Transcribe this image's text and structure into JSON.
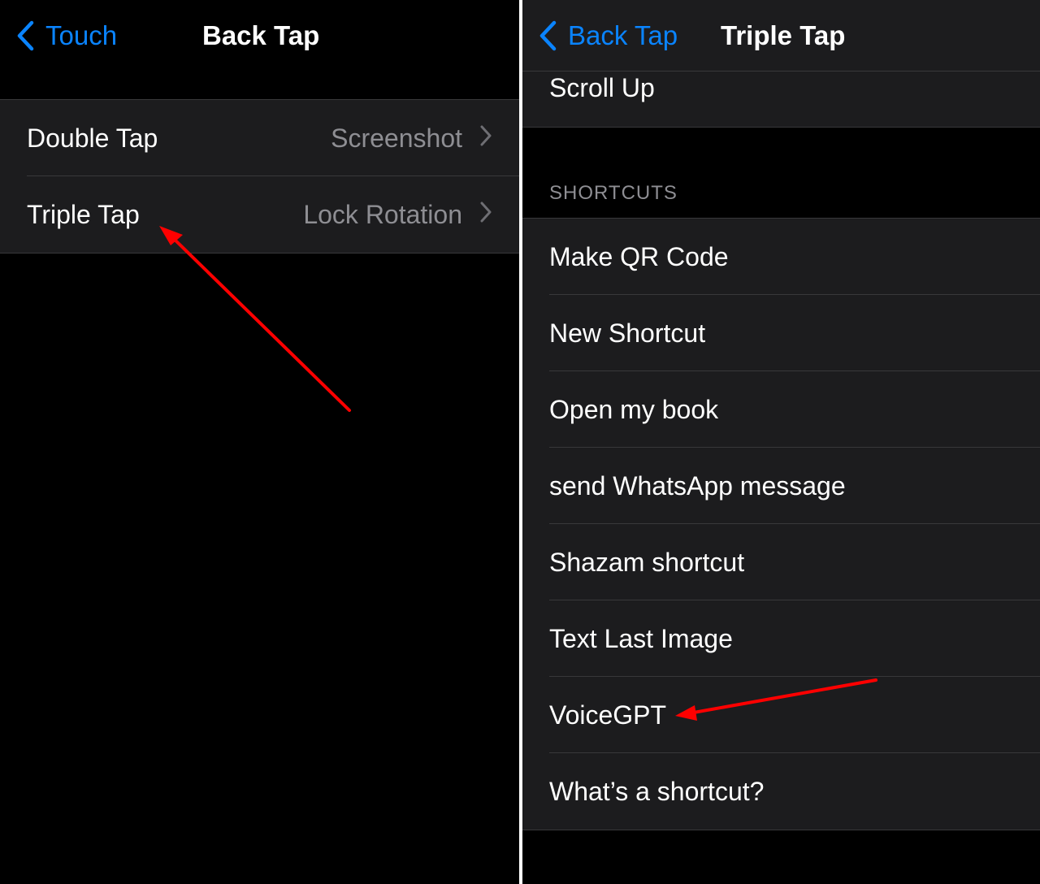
{
  "left": {
    "nav": {
      "back_label": "Touch",
      "title": "Back Tap"
    },
    "rows": [
      {
        "label": "Double Tap",
        "value": "Screenshot"
      },
      {
        "label": "Triple Tap",
        "value": "Lock Rotation"
      }
    ]
  },
  "right": {
    "nav": {
      "back_label": "Back Tap",
      "title": "Triple Tap"
    },
    "top_row": {
      "label": "Scroll Up"
    },
    "section_header": "SHORTCUTS",
    "shortcuts": [
      "Make QR Code",
      "New Shortcut",
      "Open my book",
      "send WhatsApp message",
      "Shazam shortcut",
      "Text Last Image",
      "VoiceGPT",
      "What’s a shortcut?"
    ]
  },
  "colors": {
    "accent": "#0a84ff",
    "cell_bg": "#1c1c1e",
    "separator": "#38383a",
    "secondary_text": "#8e8e93",
    "annotation_arrow": "#ff0000"
  },
  "icons": {
    "back": "chevron-left-icon",
    "disclosure": "chevron-right-icon"
  }
}
